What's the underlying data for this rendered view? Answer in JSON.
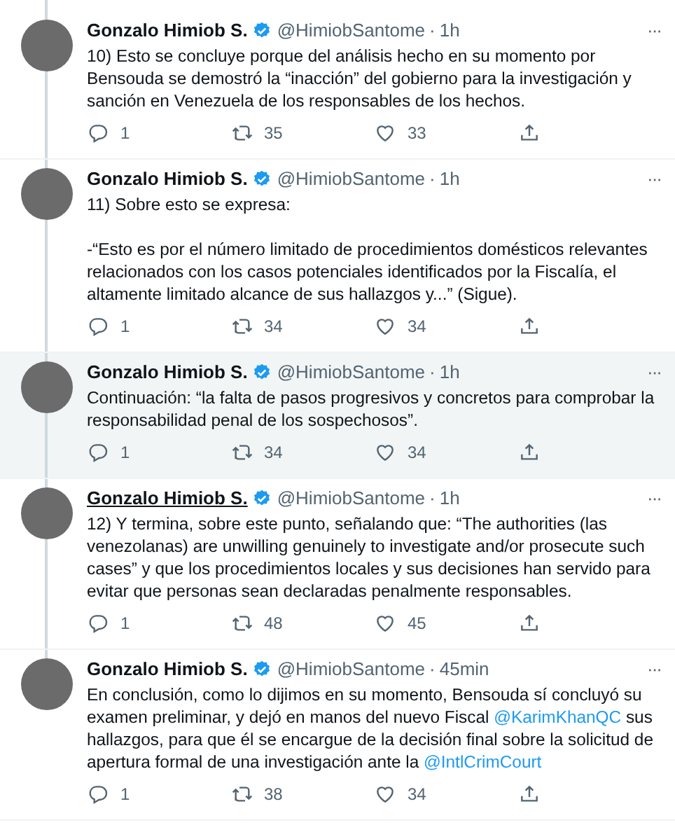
{
  "tweets": [
    {
      "name": "Gonzalo Himiob S.",
      "verified": true,
      "handle": "@HimiobSantome",
      "separator": "·",
      "time": "1h",
      "highlighted": false,
      "name_underlined": false,
      "more": "···",
      "paragraphs": [
        [
          {
            "kind": "text",
            "text": "10) Esto se concluye porque del análisis hecho en su momento por Bensouda se demostró la “inacción” del gobierno para la investigación y sanción en Venezuela de los responsables de los hechos."
          }
        ]
      ],
      "replies": "1",
      "retweets": "35",
      "likes": "33"
    },
    {
      "name": "Gonzalo Himiob S.",
      "verified": true,
      "handle": "@HimiobSantome",
      "separator": "·",
      "time": "1h",
      "highlighted": false,
      "name_underlined": false,
      "more": "···",
      "paragraphs": [
        [
          {
            "kind": "text",
            "text": "11) Sobre esto se expresa:"
          }
        ],
        [
          {
            "kind": "text",
            "text": "-“Esto es por el número limitado de procedimientos domésticos relevantes relacionados con los casos potenciales identificados por la Fiscalía, el altamente limitado alcance de sus hallazgos y...” (Sigue)."
          }
        ]
      ],
      "replies": "1",
      "retweets": "34",
      "likes": "34"
    },
    {
      "name": "Gonzalo Himiob S.",
      "verified": true,
      "handle": "@HimiobSantome",
      "separator": "·",
      "time": "1h",
      "highlighted": true,
      "name_underlined": false,
      "more": "···",
      "paragraphs": [
        [
          {
            "kind": "text",
            "text": "Continuación: “la falta de pasos progresivos y concretos para comprobar la responsabilidad penal de los sospechosos”."
          }
        ]
      ],
      "replies": "1",
      "retweets": "34",
      "likes": "34"
    },
    {
      "name": "Gonzalo Himiob S.",
      "verified": true,
      "handle": "@HimiobSantome",
      "separator": "·",
      "time": "1h",
      "highlighted": false,
      "name_underlined": true,
      "more": "···",
      "paragraphs": [
        [
          {
            "kind": "text",
            "text": "12) Y termina, sobre este punto, señalando que: “The authorities (las venezolanas) are unwilling genuinely to investigate and/or prosecute such cases” y que los procedimientos locales y sus decisiones han servido para evitar que personas sean declaradas penalmente responsables."
          }
        ]
      ],
      "replies": "1",
      "retweets": "48",
      "likes": "45"
    },
    {
      "name": "Gonzalo Himiob S.",
      "verified": true,
      "handle": "@HimiobSantome",
      "separator": "·",
      "time": "45min",
      "highlighted": false,
      "name_underlined": false,
      "more": "···",
      "paragraphs": [
        [
          {
            "kind": "text",
            "text": "En conclusión, como lo dijimos en su momento, Bensouda sí concluyó su examen preliminar, y dejó en manos del nuevo Fiscal "
          },
          {
            "kind": "mention",
            "text": "@KarimKhanQC"
          },
          {
            "kind": "text",
            "text": " sus hallazgos, para que él se encargue de la decisión final sobre la solicitud de apertura formal de una investigación ante la "
          },
          {
            "kind": "mention",
            "text": "@IntlCrimCourt"
          }
        ]
      ],
      "replies": "1",
      "retweets": "38",
      "likes": "34"
    }
  ]
}
